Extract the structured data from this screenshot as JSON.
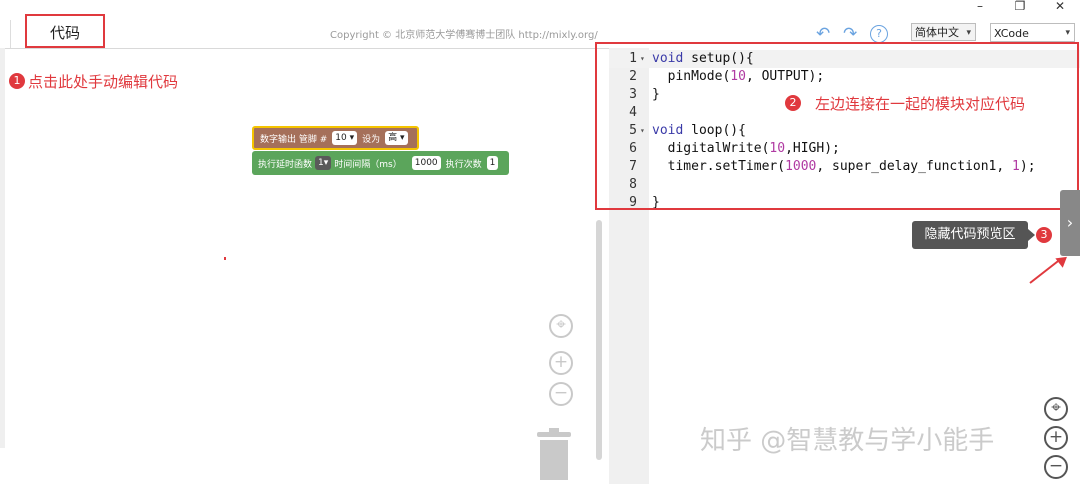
{
  "window_controls": {
    "minimize": "–",
    "maximize": "❐",
    "close": "✕"
  },
  "topbar": {
    "tab_label": "代码",
    "copyright": "Copyright © 北京师范大学傅骞博士团队 http://mixly.org/",
    "undo_glyph": "↶",
    "redo_glyph": "↷",
    "help_glyph": "?",
    "language_select": "简体中文",
    "theme_select": "XCode",
    "select_caret": "▾"
  },
  "annotations": [
    {
      "badge": "1",
      "text": "点击此处手动编辑代码"
    },
    {
      "badge": "2",
      "text": "左边连接在一起的模块对应代码"
    },
    {
      "badge": "3",
      "text": ""
    }
  ],
  "blocks": {
    "digital_out": {
      "label": "数字输出 管脚 #",
      "pin": "10",
      "set_label": "设为",
      "value": "高"
    },
    "timer": {
      "label": "执行延时函数",
      "func": "1",
      "interval_label": "时间间隔（ms）",
      "interval": "1000",
      "times_label": "执行次数",
      "times": "1"
    }
  },
  "workspace_controls": {
    "center": "⌖",
    "zoom_in": "+",
    "zoom_out": "−"
  },
  "code_lines": [
    {
      "num": "1",
      "fold": "▾",
      "text": "void setup(){"
    },
    {
      "num": "2",
      "fold": "",
      "text": "  pinMode(10, OUTPUT);"
    },
    {
      "num": "3",
      "fold": "",
      "text": "}"
    },
    {
      "num": "4",
      "fold": "",
      "text": ""
    },
    {
      "num": "5",
      "fold": "▾",
      "text": "void loop(){"
    },
    {
      "num": "6",
      "fold": "",
      "text": "  digitalWrite(10,HIGH);"
    },
    {
      "num": "7",
      "fold": "",
      "text": "  timer.setTimer(1000, super_delay_function1, 1);"
    },
    {
      "num": "8",
      "fold": "",
      "text": ""
    },
    {
      "num": "9",
      "fold": "",
      "text": "}"
    }
  ],
  "hide_panel": {
    "chevron": "›",
    "tooltip": "隐藏代码预览区"
  },
  "watermark": "知乎 @智慧教与学小能手",
  "colors": {
    "annotation_red": "#e0393e",
    "block_brown": "#a5705a",
    "block_green": "#5ba55b",
    "keyword_blue": "#3a3aa8"
  }
}
